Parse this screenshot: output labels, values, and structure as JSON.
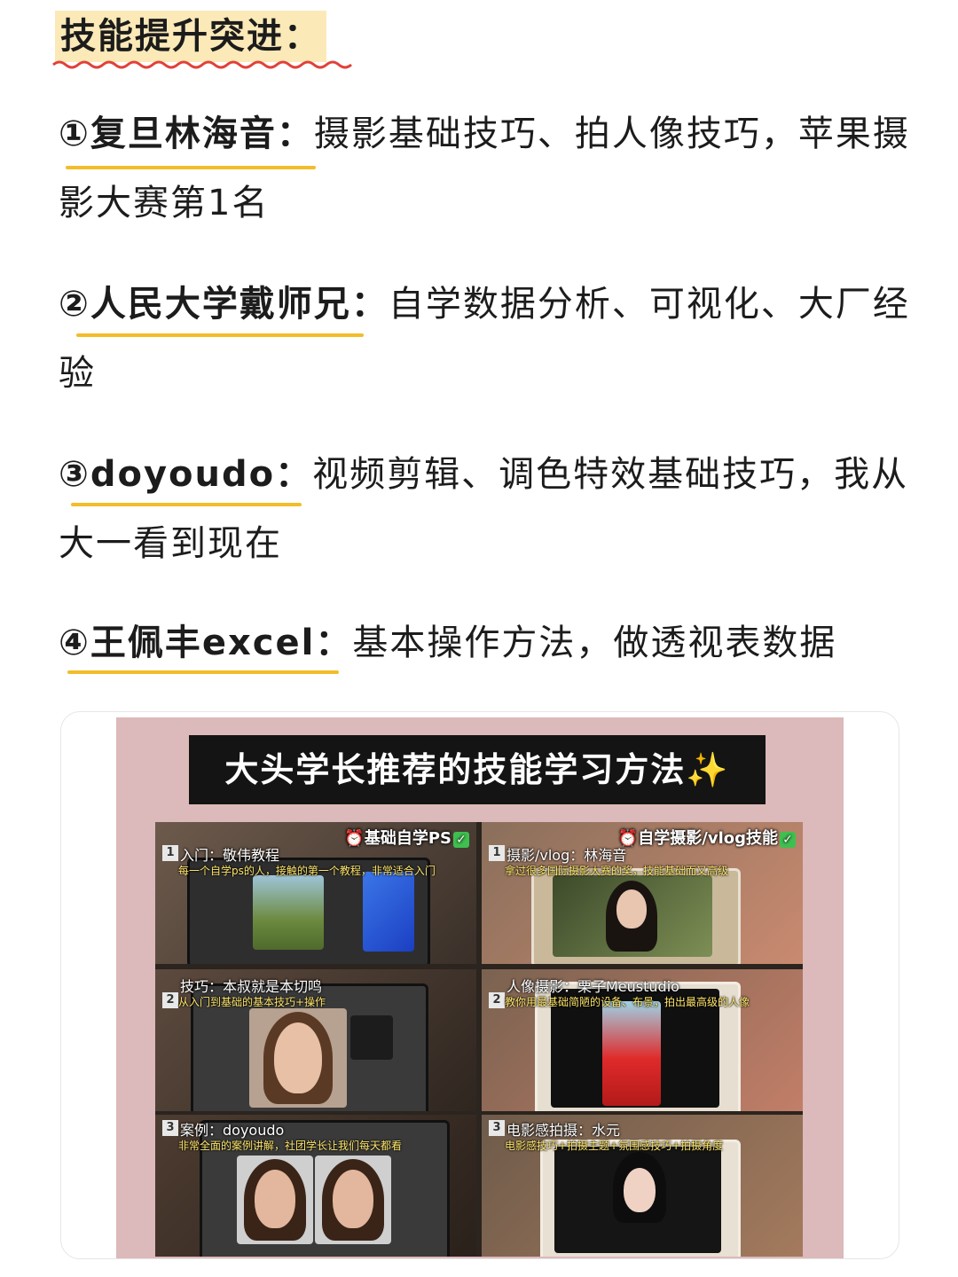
{
  "heading": "技能提升突进：",
  "items": [
    {
      "title": "①复旦林海音：",
      "desc": "摄影基础技巧、拍人像技巧，苹果摄影大赛第1名"
    },
    {
      "title": "②人民大学戴师兄：",
      "desc": "自学数据分析、可视化、大厂经验"
    },
    {
      "title": "③doyoudo：",
      "desc": "视频剪辑、调色特效基础技巧，我从大一看到现在"
    },
    {
      "title": "④王佩丰excel：",
      "desc": "基本操作方法，做透视表数据"
    }
  ],
  "poster": {
    "banner": "大头学长推荐的技能学习方法",
    "left_badge": "⏰基础自学PS",
    "right_badge": "⏰自学摄影/vlog技能",
    "cells": [
      {
        "num": "1",
        "title": "入门：敬伟教程",
        "desc": "每一个自学ps的人，接触的第一个教程，非常适合入门"
      },
      {
        "num": "1",
        "title": "摄影/vlog：林海音",
        "desc": "拿过很多国际摄影大赛的奖，技能基础而又高级"
      },
      {
        "num": "2",
        "title": "技巧：本叔就是本切鸣",
        "desc": "从入门到基础的基本技巧+操作"
      },
      {
        "num": "2",
        "title": "人像摄影：栗子Meustudio",
        "desc": "教你用最基础简陋的设备、布景，拍出最高级的人像"
      },
      {
        "num": "3",
        "title": "案例：doyoudo",
        "desc": "非常全面的案例讲解，社团学长让我们每天都看"
      },
      {
        "num": "3",
        "title": "电影感拍摄：水元",
        "desc": "电影感技巧+拍摄主题+氛围感技巧+拍摄角度"
      }
    ]
  },
  "colors": {
    "highlight": "#fbe9b8",
    "underline": "#f3bd2a",
    "wave": "#e0413a",
    "poster_bg": "#dcb9ba"
  }
}
